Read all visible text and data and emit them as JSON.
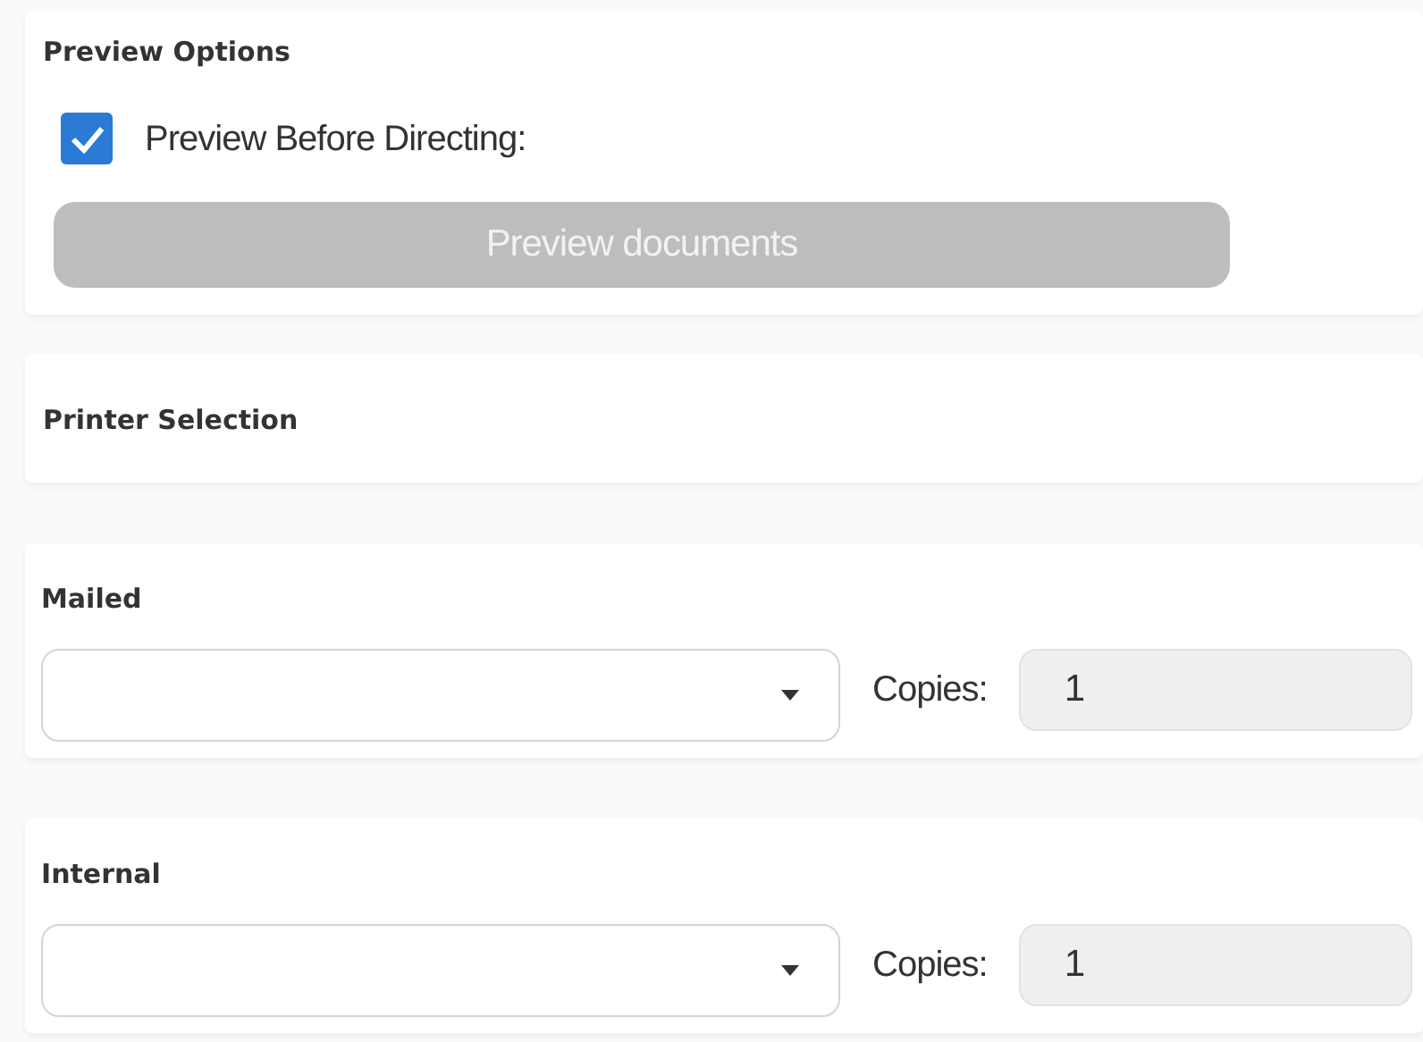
{
  "preview_options": {
    "title": "Preview Options",
    "checkbox": {
      "label": "Preview Before Directing:",
      "checked": true
    },
    "button": {
      "label": "Preview documents",
      "disabled": true
    }
  },
  "printer_selection": {
    "title": "Printer Selection"
  },
  "printers": [
    {
      "title": "Mailed",
      "copies_label": "Copies:",
      "copies": {
        "value": "1",
        "disabled": true
      }
    },
    {
      "title": "Internal",
      "copies_label": "Copies:",
      "copies": {
        "value": "1",
        "disabled": true
      }
    }
  ]
}
